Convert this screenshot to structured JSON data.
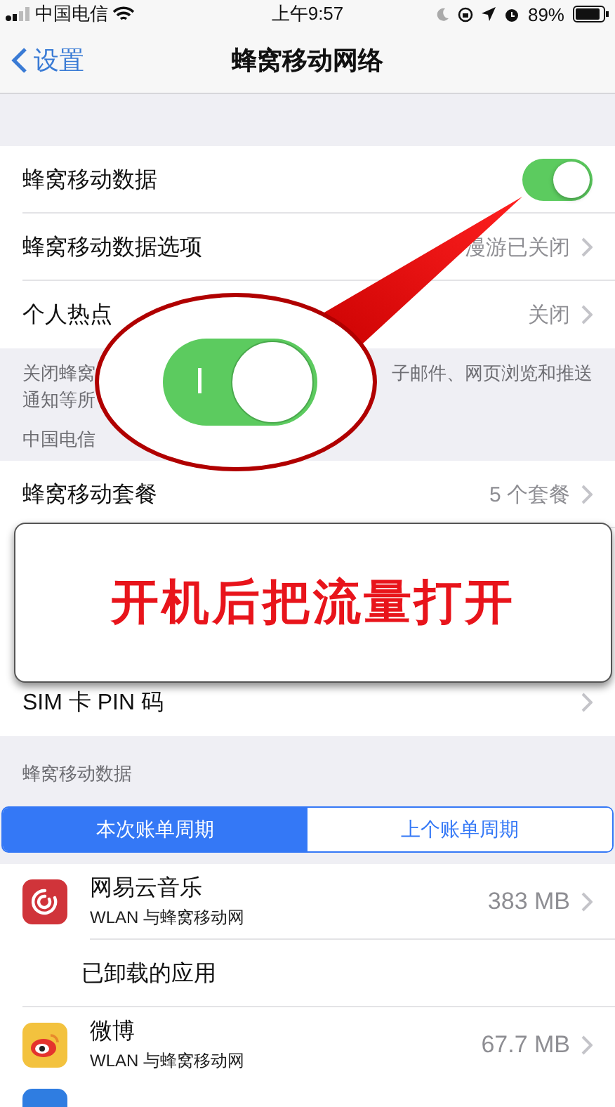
{
  "status_bar": {
    "carrier": "中国电信",
    "time": "上午9:57",
    "battery": "89%"
  },
  "nav": {
    "back": "设置",
    "title": "蜂窝移动网络"
  },
  "section1": {
    "rows": [
      {
        "kind": "toggle",
        "label": "蜂窝移动数据",
        "on": true
      },
      {
        "kind": "link",
        "label": "蜂窝移动数据选项",
        "value": "漫游已关闭"
      },
      {
        "kind": "link",
        "label": "个人热点",
        "value": "关闭"
      }
    ],
    "footer_parts": [
      "关闭蜂窝",
      "子邮件、网页浏览和推送",
      "通知等所"
    ]
  },
  "carrier_section": {
    "header": "中国电信",
    "rows": [
      {
        "kind": "link",
        "label": "蜂窝移动套餐",
        "value": "5 个套餐"
      },
      {
        "kind": "hidden"
      },
      {
        "kind": "hidden"
      },
      {
        "kind": "link",
        "label": "SIM 卡 PIN 码"
      }
    ]
  },
  "usage_section": {
    "header": "蜂窝移动数据",
    "tabs": [
      {
        "label": "本次账单周期",
        "selected": true
      },
      {
        "label": "上个账单周期",
        "selected": false
      }
    ],
    "apps": [
      {
        "kind": "app",
        "color": "#d0343a",
        "name": "网易云音乐",
        "detail": "WLAN 与蜂窝移动网",
        "usage": "383 MB"
      },
      {
        "kind": "group",
        "name": "已卸载的应用"
      },
      {
        "kind": "app",
        "color": "#f3c23e",
        "name": "微博",
        "detail": "WLAN 与蜂窝移动网",
        "usage": "67.7 MB"
      },
      {
        "kind": "partial",
        "color": "#2f7de1"
      }
    ]
  },
  "annotation": {
    "magnified_toggle_on": true,
    "caption": "开机后把流量打开"
  }
}
